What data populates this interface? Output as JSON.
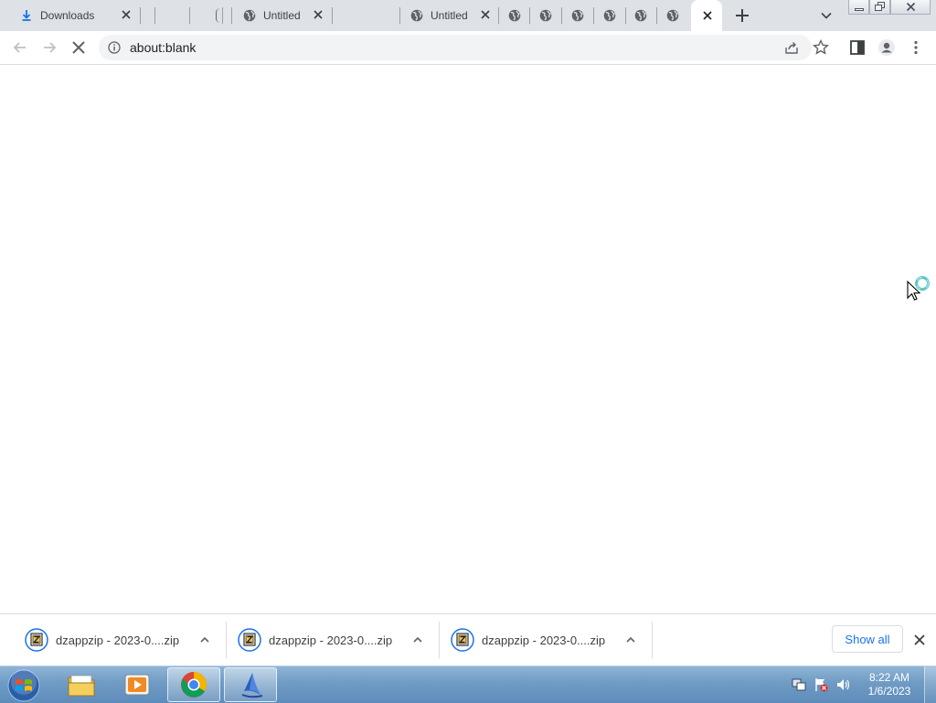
{
  "tabs": [
    {
      "title": "Downloads",
      "icon": "download-icon",
      "has_close": true
    },
    {
      "title": "",
      "icon": "",
      "has_close": false
    },
    {
      "title": "",
      "icon": "",
      "has_close": false
    },
    {
      "title": "",
      "icon": "",
      "has_close": false
    },
    {
      "title": "Untitled",
      "icon": "globe-icon",
      "has_close": true
    },
    {
      "title": "",
      "icon": "",
      "has_close": false
    },
    {
      "title": "Untitled",
      "icon": "globe-icon",
      "has_close": true
    },
    {
      "title": "",
      "icon": "globe-icon",
      "has_close": false
    },
    {
      "title": "",
      "icon": "globe-icon",
      "has_close": false
    },
    {
      "title": "",
      "icon": "globe-icon",
      "has_close": false
    },
    {
      "title": "",
      "icon": "globe-icon",
      "has_close": false
    },
    {
      "title": "",
      "icon": "globe-icon",
      "has_close": false
    },
    {
      "title": "",
      "icon": "globe-icon",
      "has_close": false
    },
    {
      "title": "",
      "icon": "",
      "has_close": true,
      "active": true
    }
  ],
  "toolbar": {
    "url": "about:blank",
    "back_icon": "back-arrow-icon",
    "forward_icon": "forward-arrow-icon",
    "stop_icon": "stop-loading-icon",
    "site_info_icon": "info-icon",
    "share_icon": "share-icon",
    "bookmark_icon": "star-icon",
    "side_panel_icon": "side-panel-icon",
    "profile_icon": "profile-icon",
    "menu_icon": "kebab-menu-icon"
  },
  "downloads": {
    "items": [
      {
        "filename": "dzappzip - 2023-0....zip"
      },
      {
        "filename": "dzappzip - 2023-0....zip"
      },
      {
        "filename": "dzappzip - 2023-0....zip"
      }
    ],
    "show_all_label": "Show all"
  },
  "taskbar": {
    "apps": [
      "windows-start-icon",
      "file-explorer-icon",
      "media-player-icon",
      "chrome-icon",
      "app-sail-icon"
    ],
    "tray_icons": [
      "network-icon",
      "action-center-icon",
      "volume-icon"
    ],
    "time": "8:22 AM",
    "date": "1/6/2023"
  },
  "colors": {
    "tabstrip_bg": "#dee1e6",
    "accent_blue": "#1a73e8",
    "taskbar_blue": "#6f9bc4"
  }
}
